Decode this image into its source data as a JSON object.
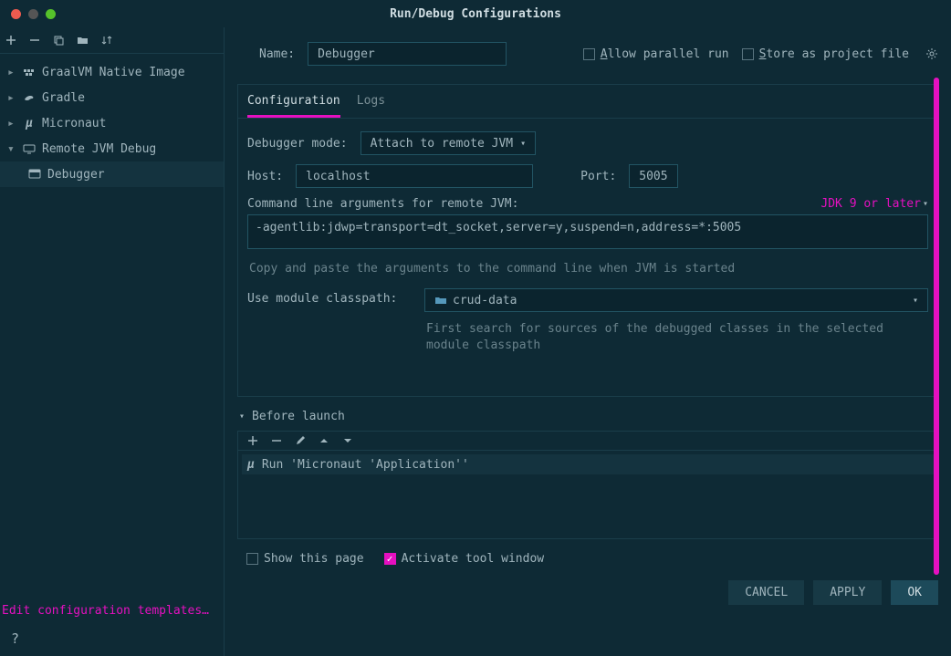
{
  "title": "Run/Debug Configurations",
  "sidebar": {
    "items": [
      {
        "label": "GraalVM Native Image",
        "icon": "graal"
      },
      {
        "label": "Gradle",
        "icon": "gradle"
      },
      {
        "label": "Micronaut",
        "icon": "mu"
      },
      {
        "label": "Remote JVM Debug",
        "icon": "remote"
      }
    ],
    "child": {
      "label": "Debugger"
    },
    "edit_templates": "Edit configuration templates…"
  },
  "top": {
    "name_label": "Name:",
    "name_value": "Debugger",
    "allow_parallel": "Allow parallel run",
    "store_file": "Store as project file"
  },
  "tabs": {
    "config": "Configuration",
    "logs": "Logs"
  },
  "form": {
    "debugger_mode_label": "Debugger mode:",
    "debugger_mode_value": "Attach to remote JVM",
    "host_label": "Host:",
    "host_value": "localhost",
    "port_label": "Port:",
    "port_value": "5005",
    "cmd_label": "Command line arguments for remote JVM:",
    "jdk_link": "JDK 9 or later",
    "cmd_value": "-agentlib:jdwp=transport=dt_socket,server=y,suspend=n,address=*:5005",
    "cmd_hint": "Copy and paste the arguments to the command line when JVM is started",
    "module_label": "Use module classpath:",
    "module_value": "crud-data",
    "module_hint": "First search for sources of the debugged classes in the selected module classpath"
  },
  "before_launch": {
    "title": "Before launch",
    "task": "Run 'Micronaut 'Application''"
  },
  "bottom": {
    "show_page": "Show this page",
    "activate": "Activate tool window"
  },
  "buttons": {
    "cancel": "CANCEL",
    "apply": "APPLY",
    "ok": "OK"
  }
}
